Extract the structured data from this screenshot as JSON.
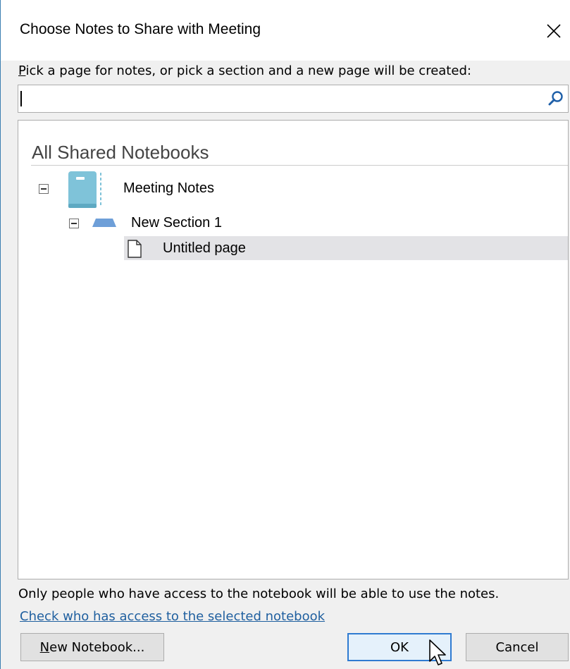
{
  "dialog": {
    "title": "Choose Notes to Share with Meeting"
  },
  "prompt": {
    "underlined_char": "P",
    "rest": "ick a page for notes, or pick a section and a new page will be created:"
  },
  "search": {
    "value": "",
    "placeholder": ""
  },
  "tree": {
    "header": "All Shared Notebooks",
    "notebook": {
      "label": "Meeting Notes",
      "color": "#7fc3d9"
    },
    "section": {
      "label": "New Section 1",
      "color": "#6e9fd8"
    },
    "page": {
      "label": "Untitled page",
      "selected": true
    }
  },
  "footer": {
    "info": "Only people who have access to the notebook will be able to use the notes.",
    "link": "Check who has access to the selected notebook"
  },
  "buttons": {
    "new_notebook_underlined": "N",
    "new_notebook_rest": "ew Notebook...",
    "ok": "OK",
    "cancel": "Cancel"
  },
  "colors": {
    "accent": "#2f7bd1",
    "link": "#1f5f9f",
    "selection": "#e3e3e6"
  }
}
